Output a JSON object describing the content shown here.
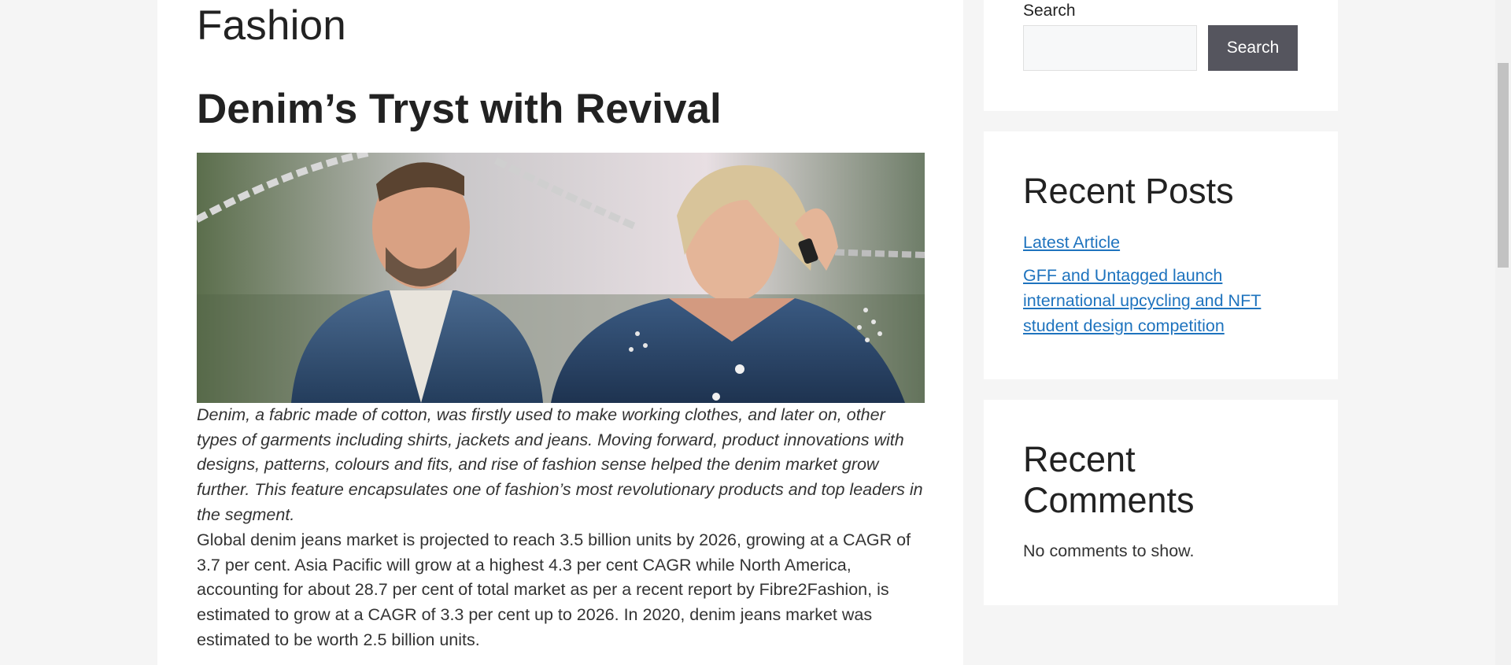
{
  "category": {
    "title": "Fashion"
  },
  "post": {
    "title": "Denim’s Tryst with Revival",
    "intro": "Denim, a fabric made of cotton, was firstly used to make working clothes, and later on, other types of garments including shirts, jackets and jeans. Moving forward, product innovations with designs, patterns, colours and fits, and rise of fashion sense helped the denim market grow further. This feature encapsulates one of fashion’s most revolutionary products and top leaders in the segment.",
    "body": "Global denim jeans market is projected to reach 3.5 billion units by 2026, growing at a CAGR of 3.7 per cent. Asia Pacific will grow at a highest 4.3 per cent CAGR while North America, accounting for about 28.7 per cent of total market as per a recent report by Fibre2Fashion, is estimated to grow at a CAGR of 3.3 per cent up to 2026. In 2020, denim jeans market was estimated to be worth 2.5 billion units."
  },
  "sidebar": {
    "search": {
      "label": "Search",
      "placeholder": "",
      "value": "",
      "button": "Search"
    },
    "recent_posts": {
      "title": "Recent Posts",
      "items": [
        {
          "label": "Latest Article"
        },
        {
          "label": "GFF and Untagged launch international upcycling and NFT student design competition"
        }
      ]
    },
    "recent_comments": {
      "title": "Recent Comments",
      "empty_text": "No comments to show."
    }
  },
  "colors": {
    "page_background": "#f5f5f5",
    "link": "#1e73be",
    "button": "#55555e",
    "denim": "#2f4f73"
  }
}
